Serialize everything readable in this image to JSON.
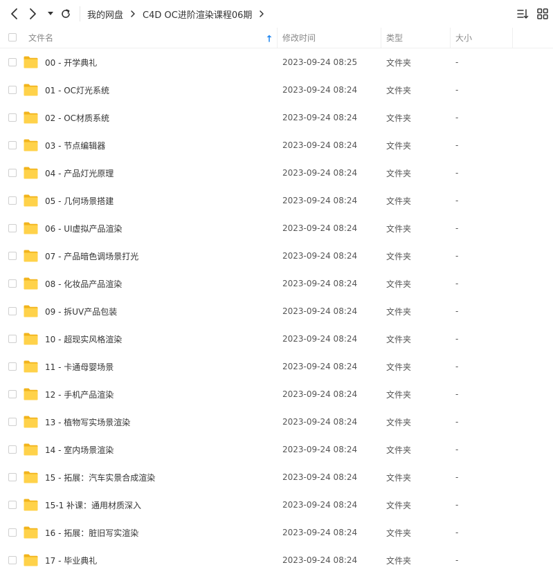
{
  "toolbar": {
    "back_icon": "chevron-left-icon",
    "forward_icon": "chevron-right-icon",
    "dropdown_icon": "caret-down-icon",
    "refresh_icon": "refresh-icon",
    "sort_icon": "sort-lines-icon",
    "grid_icon": "grid-view-icon"
  },
  "breadcrumb": {
    "items": [
      "我的网盘",
      "C4D OC进阶渲染课程06期"
    ]
  },
  "header": {
    "name": "文件名",
    "modified": "修改时间",
    "type": "类型",
    "size": "大小"
  },
  "files": [
    {
      "name": "00 - 开学典礼",
      "modified": "2023-09-24 08:25",
      "type": "文件夹",
      "size": "-"
    },
    {
      "name": "01 - OC灯光系统",
      "modified": "2023-09-24 08:24",
      "type": "文件夹",
      "size": "-"
    },
    {
      "name": "02 - OC材质系统",
      "modified": "2023-09-24 08:24",
      "type": "文件夹",
      "size": "-"
    },
    {
      "name": "03 - 节点编辑器",
      "modified": "2023-09-24 08:24",
      "type": "文件夹",
      "size": "-"
    },
    {
      "name": "04 - 产品灯光原理",
      "modified": "2023-09-24 08:24",
      "type": "文件夹",
      "size": "-"
    },
    {
      "name": "05 - 几何场景搭建",
      "modified": "2023-09-24 08:24",
      "type": "文件夹",
      "size": "-"
    },
    {
      "name": "06 - UI虚拟产品渲染",
      "modified": "2023-09-24 08:24",
      "type": "文件夹",
      "size": "-"
    },
    {
      "name": "07 - 产品暗色调场景打光",
      "modified": "2023-09-24 08:24",
      "type": "文件夹",
      "size": "-"
    },
    {
      "name": "08 - 化妆品产品渲染",
      "modified": "2023-09-24 08:24",
      "type": "文件夹",
      "size": "-"
    },
    {
      "name": "09 - 拆UV产品包装",
      "modified": "2023-09-24 08:24",
      "type": "文件夹",
      "size": "-"
    },
    {
      "name": "10 - 超现实风格渲染",
      "modified": "2023-09-24 08:24",
      "type": "文件夹",
      "size": "-"
    },
    {
      "name": "11 - 卡通母婴场景",
      "modified": "2023-09-24 08:24",
      "type": "文件夹",
      "size": "-"
    },
    {
      "name": "12 - 手机产品渲染",
      "modified": "2023-09-24 08:24",
      "type": "文件夹",
      "size": "-"
    },
    {
      "name": "13 - 植物写实场景渲染",
      "modified": "2023-09-24 08:24",
      "type": "文件夹",
      "size": "-"
    },
    {
      "name": "14 - 室内场景渲染",
      "modified": "2023-09-24 08:24",
      "type": "文件夹",
      "size": "-"
    },
    {
      "name": "15 - 拓展：汽车实景合成渲染",
      "modified": "2023-09-24 08:24",
      "type": "文件夹",
      "size": "-"
    },
    {
      "name": "15-1 补课：通用材质深入",
      "modified": "2023-09-24 08:24",
      "type": "文件夹",
      "size": "-"
    },
    {
      "name": "16 - 拓展：脏旧写实渲染",
      "modified": "2023-09-24 08:24",
      "type": "文件夹",
      "size": "-"
    },
    {
      "name": "17 - 毕业典礼",
      "modified": "2023-09-24 08:24",
      "type": "文件夹",
      "size": "-"
    }
  ],
  "colors": {
    "folder": "#f7c32e",
    "folder_light": "#ffd95a",
    "sort_arrow": "#2a8cf0"
  }
}
